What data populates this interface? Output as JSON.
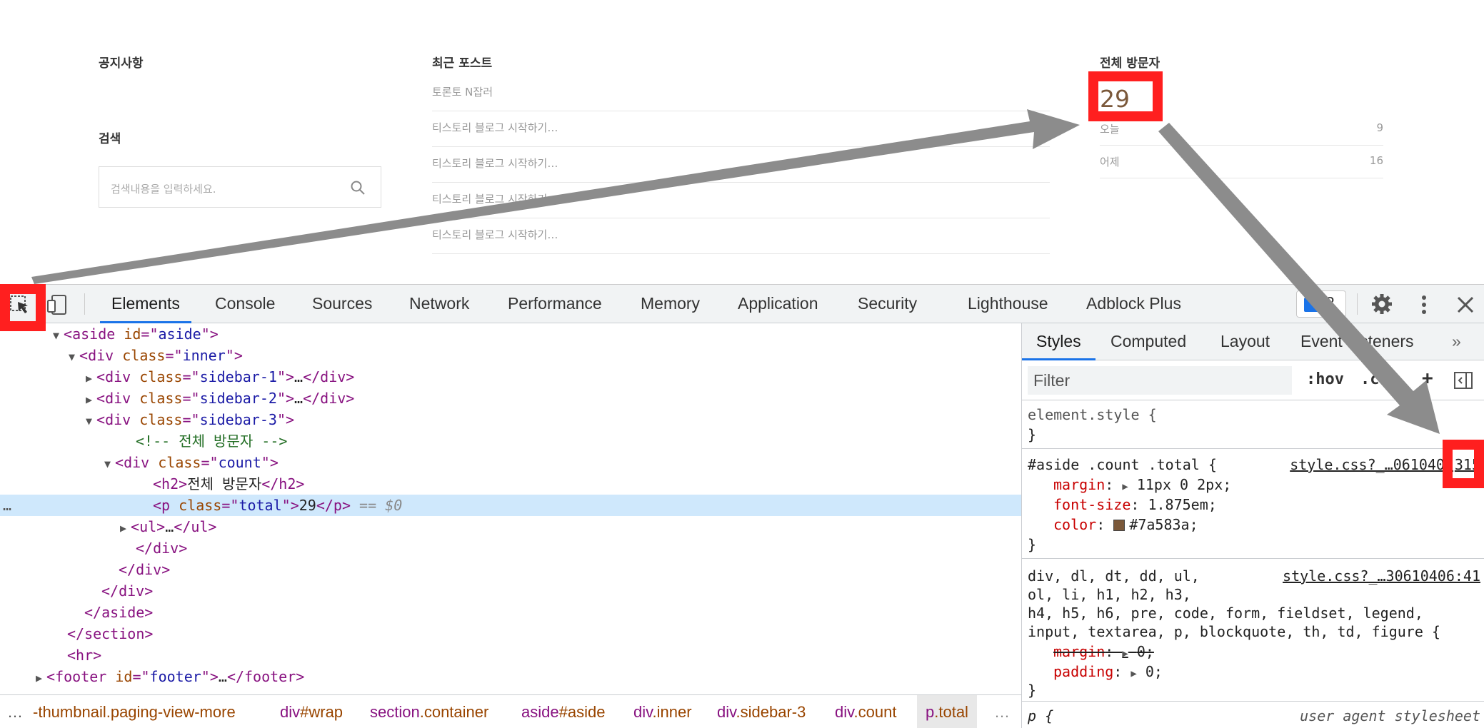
{
  "blog": {
    "notice_title": "공지사항",
    "search_title": "검색",
    "search_placeholder": "검색내용을 입력하세요.",
    "recent_title": "최근 포스트",
    "recent_posts": [
      "토론토 N잡러",
      "티스토리 블로그 시작하기…",
      "티스토리 블로그 시작하기…",
      "티스토리 블로그 시작하기…",
      "티스토리 블로그 시작하기…"
    ],
    "visitors_title": "전체 방문자",
    "visitors_total": "29",
    "today_label": "오늘",
    "today_value": "9",
    "yesterday_label": "어제",
    "yesterday_value": "16"
  },
  "devtools": {
    "tabs": [
      "Elements",
      "Console",
      "Sources",
      "Network",
      "Performance",
      "Memory",
      "Application",
      "Security",
      "Lighthouse",
      "Adblock Plus"
    ],
    "active_tab": "Elements",
    "message_count": "2",
    "dom_lines": [
      {
        "t": "▼",
        "parts": [
          [
            "tag",
            "<aside "
          ],
          [
            "attr",
            "id"
          ],
          [
            "tag",
            "=\""
          ],
          [
            "val",
            "aside"
          ],
          [
            "tag",
            "\">"
          ]
        ]
      },
      {
        "t": "▼",
        "parts": [
          [
            "tag",
            "<div "
          ],
          [
            "attr",
            "class"
          ],
          [
            "tag",
            "=\""
          ],
          [
            "val",
            "inner"
          ],
          [
            "tag",
            "\">"
          ]
        ]
      },
      {
        "t": "▶",
        "parts": [
          [
            "tag",
            "<div "
          ],
          [
            "attr",
            "class"
          ],
          [
            "tag",
            "=\""
          ],
          [
            "val",
            "sidebar-1"
          ],
          [
            "tag",
            "\">"
          ],
          [
            "txt",
            "…"
          ],
          [
            "tag",
            "</div>"
          ]
        ]
      },
      {
        "t": "▶",
        "parts": [
          [
            "tag",
            "<div "
          ],
          [
            "attr",
            "class"
          ],
          [
            "tag",
            "=\""
          ],
          [
            "val",
            "sidebar-2"
          ],
          [
            "tag",
            "\">"
          ],
          [
            "txt",
            "…"
          ],
          [
            "tag",
            "</div>"
          ]
        ]
      },
      {
        "t": "▼",
        "parts": [
          [
            "tag",
            "<div "
          ],
          [
            "attr",
            "class"
          ],
          [
            "tag",
            "=\""
          ],
          [
            "val",
            "sidebar-3"
          ],
          [
            "tag",
            "\">"
          ]
        ]
      },
      {
        "t": "",
        "parts": [
          [
            "cm",
            "<!-- 전체 방문자 -->"
          ]
        ]
      },
      {
        "t": "▼",
        "parts": [
          [
            "tag",
            "<div "
          ],
          [
            "attr",
            "class"
          ],
          [
            "tag",
            "=\""
          ],
          [
            "val",
            "count"
          ],
          [
            "tag",
            "\">"
          ]
        ]
      },
      {
        "t": "",
        "parts": [
          [
            "tag",
            "<h2>"
          ],
          [
            "txt",
            "전체 방문자"
          ],
          [
            "tag",
            "</h2>"
          ]
        ]
      },
      {
        "t": "",
        "parts": [
          [
            "tag",
            "<p "
          ],
          [
            "attr",
            "class"
          ],
          [
            "tag",
            "=\""
          ],
          [
            "val",
            "total"
          ],
          [
            "tag",
            "\">"
          ],
          [
            "txt",
            "29"
          ],
          [
            "tag",
            "</p>"
          ],
          [
            "dim",
            " == "
          ],
          [
            "dollar",
            "$0"
          ]
        ]
      },
      {
        "t": "▶",
        "parts": [
          [
            "tag",
            "<ul>"
          ],
          [
            "txt",
            "…"
          ],
          [
            "tag",
            "</ul>"
          ]
        ]
      },
      {
        "t": "",
        "parts": [
          [
            "tag",
            "</div>"
          ]
        ]
      },
      {
        "t": "",
        "parts": [
          [
            "tag",
            "</div>"
          ]
        ]
      },
      {
        "t": "",
        "parts": [
          [
            "tag",
            "</div>"
          ]
        ]
      },
      {
        "t": "",
        "parts": [
          [
            "tag",
            "</aside>"
          ]
        ]
      },
      {
        "t": "",
        "parts": [
          [
            "tag",
            "</section>"
          ]
        ]
      },
      {
        "t": "",
        "parts": [
          [
            "tag",
            "<hr>"
          ]
        ]
      },
      {
        "t": "▶",
        "parts": [
          [
            "tag",
            "<footer "
          ],
          [
            "attr",
            "id"
          ],
          [
            "tag",
            "=\""
          ],
          [
            "val",
            "footer"
          ],
          [
            "tag",
            "\">"
          ],
          [
            "txt",
            "…"
          ],
          [
            "tag",
            "</footer>"
          ]
        ]
      }
    ],
    "selected_ellipsis": "…",
    "breadcrumbs": [
      {
        "a": "-thumbnail.paging-view-more",
        "b": ""
      },
      {
        "a": "div",
        "b": "#wrap"
      },
      {
        "a": "section",
        "b": ".container"
      },
      {
        "a": "aside",
        "b": "#aside"
      },
      {
        "a": "div",
        "b": ".inner"
      },
      {
        "a": "div",
        "b": ".sidebar-3"
      },
      {
        "a": "div",
        "b": ".count"
      },
      {
        "a": "p",
        "b": ".total"
      }
    ],
    "breadcrumb_left_ellipsis": "…",
    "breadcrumb_right_ellipsis": "…",
    "styles_tabs": [
      "Styles",
      "Computed",
      "Layout",
      "Event Listeners"
    ],
    "styles_more": "»",
    "filter_placeholder": "Filter",
    "hov_label": ":hov",
    "cls_label": ".cl",
    "plus_label": "+",
    "element_style_selector": "element.style {",
    "close_brace": "}",
    "rule1_selector": "#aside .count .total {",
    "rule1_source": "style.css?_…0610406",
    "rule1_line": "315",
    "rule1_margin_name": "margin",
    "rule1_margin_value": "11px 0 2px;",
    "rule1_fontsize_name": "font-size",
    "rule1_fontsize_value": "1.875em;",
    "rule1_color_name": "color",
    "rule1_color_value": "#7a583a;",
    "rule2_selector_lines": [
      "div, dl, dt, dd, ul,",
      "ol, li, h1, h2, h3,",
      "h4, h5, h6, pre, code, form, fieldset, legend,",
      "input, textarea, p, blockquote, th, td, figure {"
    ],
    "rule2_source": "style.css?_…30610406:41",
    "rule2_margin_name": "margin",
    "rule2_margin_value": "0;",
    "rule2_padding_name": "padding",
    "rule2_padding_value": "0;",
    "rule3_selector": "p {",
    "rule3_source": "user agent stylesheet"
  },
  "colors": {
    "highlight_red": "#ff1f1f",
    "arrow_gray": "#8c8c8c",
    "accent_blue": "#1a73e8",
    "visitor_brown": "#7a583a"
  }
}
